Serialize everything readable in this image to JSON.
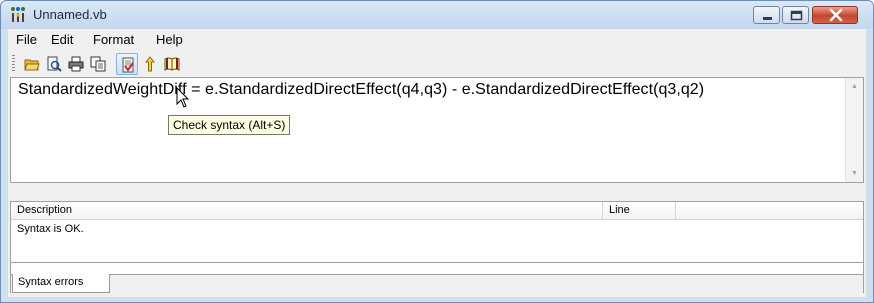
{
  "window": {
    "title": "Unnamed.vb",
    "controls": {
      "minimize": "minimize-icon",
      "maximize": "maximize-icon",
      "close": "close-icon"
    }
  },
  "menu": {
    "items": [
      {
        "label": "File"
      },
      {
        "label": "Edit"
      },
      {
        "label": "Format"
      },
      {
        "label": "Help"
      }
    ]
  },
  "toolbar": {
    "buttons": [
      {
        "icon": "open-folder-icon",
        "tooltip": ""
      },
      {
        "icon": "print-preview-icon",
        "tooltip": ""
      },
      {
        "icon": "print-icon",
        "tooltip": ""
      },
      {
        "icon": "copy-icon",
        "tooltip": ""
      },
      {
        "icon": "check-syntax-icon",
        "tooltip": "Check syntax (Alt+S)"
      },
      {
        "icon": "run-icon",
        "tooltip": ""
      },
      {
        "icon": "help-book-icon",
        "tooltip": ""
      }
    ]
  },
  "editor": {
    "code": "StandardizedWeightDiff = e.StandardizedDirectEffect(q4,q3) - e.StandardizedDirectEffect(q3,q2)"
  },
  "results": {
    "columns": [
      "Description",
      "Line"
    ],
    "rows": [
      {
        "description": "Syntax is OK.",
        "line": ""
      }
    ],
    "tab_label": "Syntax errors"
  },
  "colors": {
    "title_bar": "#c3d6ee",
    "tooltip_bg": "#ffffe1",
    "hot_button": "#c8e2fa"
  }
}
